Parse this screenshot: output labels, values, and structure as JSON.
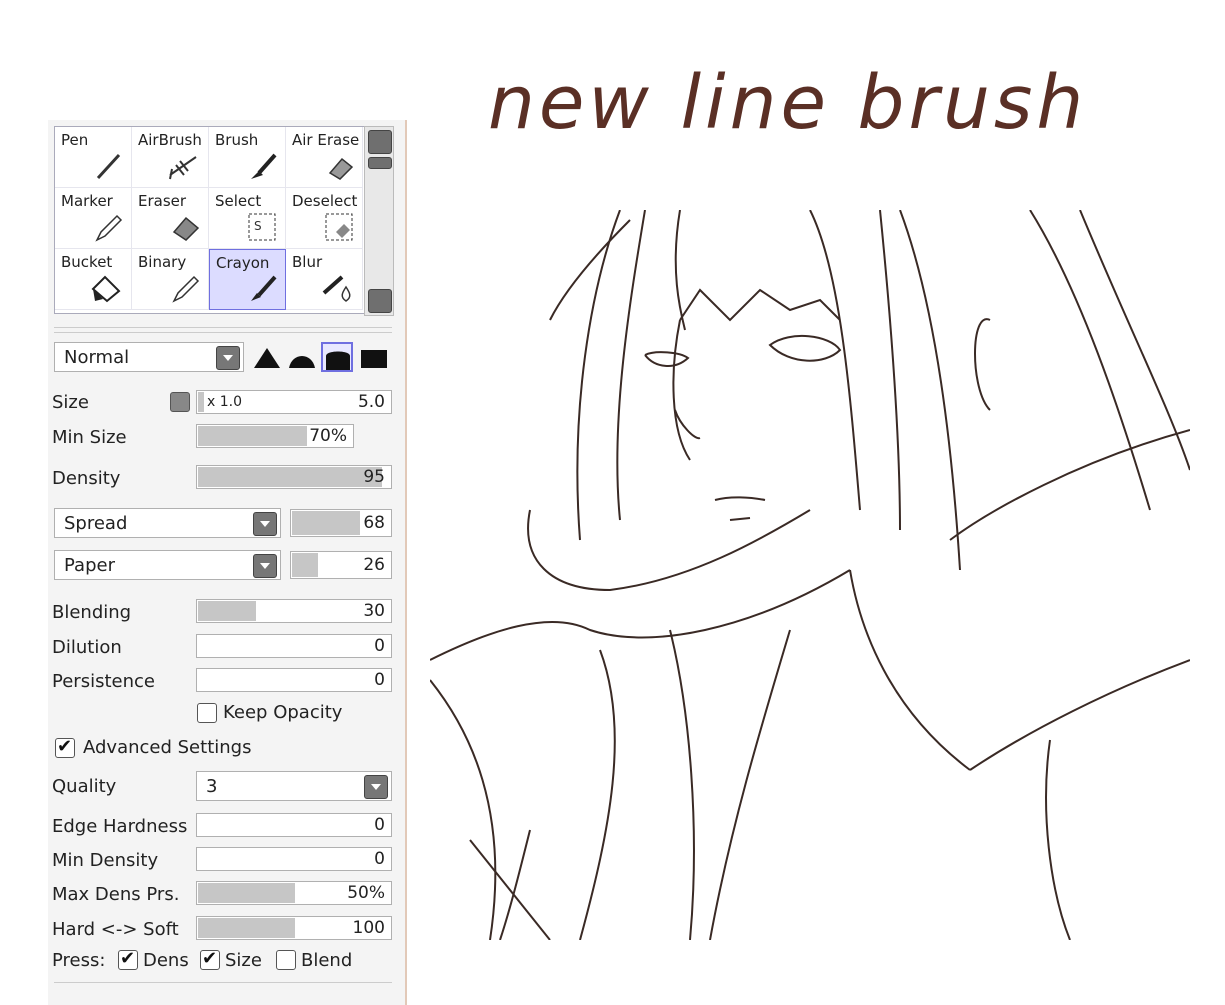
{
  "heading": "new line brush",
  "tools": [
    {
      "label": "Pen",
      "icon": "pen-icon"
    },
    {
      "label": "AirBrush",
      "icon": "airbrush-icon"
    },
    {
      "label": "Brush",
      "icon": "brush-icon"
    },
    {
      "label": "Air Erase",
      "icon": "air-eraser-icon"
    },
    {
      "label": "Marker",
      "icon": "marker-icon"
    },
    {
      "label": "Eraser",
      "icon": "eraser-icon"
    },
    {
      "label": "Select",
      "icon": "select-icon"
    },
    {
      "label": "Deselect",
      "icon": "deselect-icon"
    },
    {
      "label": "Bucket",
      "icon": "bucket-icon"
    },
    {
      "label": "Binary",
      "icon": "binary-pen-icon"
    },
    {
      "label": "Crayon",
      "icon": "crayon-icon",
      "selected": true
    },
    {
      "label": "Blur",
      "icon": "blur-icon"
    }
  ],
  "blend_mode": "Normal",
  "size": {
    "label": "Size",
    "multiplier": "x 1.0",
    "value": "5.0"
  },
  "min_size": {
    "label": "Min Size",
    "value": "70%",
    "level": 0.7
  },
  "density": {
    "label": "Density",
    "value": "95",
    "level": 0.95
  },
  "spread": {
    "label": "Spread",
    "value": "68",
    "level": 0.68
  },
  "paper": {
    "label": "Paper",
    "value": "26",
    "level": 0.26
  },
  "blending": {
    "label": "Blending",
    "value": "30",
    "level": 0.3
  },
  "dilution": {
    "label": "Dilution",
    "value": "0",
    "level": 0
  },
  "persistence": {
    "label": "Persistence",
    "value": "0",
    "level": 0
  },
  "keep_opacity": {
    "label": "Keep Opacity",
    "checked": false
  },
  "advanced": {
    "label": "Advanced Settings",
    "checked": true
  },
  "quality": {
    "label": "Quality",
    "value": "3"
  },
  "edge_hardness": {
    "label": "Edge Hardness",
    "value": "0",
    "level": 0
  },
  "min_density": {
    "label": "Min Density",
    "value": "0",
    "level": 0
  },
  "max_dens_prs": {
    "label": "Max Dens Prs.",
    "value": "50%",
    "level": 0.5
  },
  "hard_soft": {
    "label": "Hard <-> Soft",
    "value": "100",
    "level": 0.5
  },
  "press": {
    "label": "Press:",
    "dens": "Dens",
    "size": "Size",
    "blend": "Blend",
    "dens_on": true,
    "size_on": true,
    "blend_on": false
  }
}
